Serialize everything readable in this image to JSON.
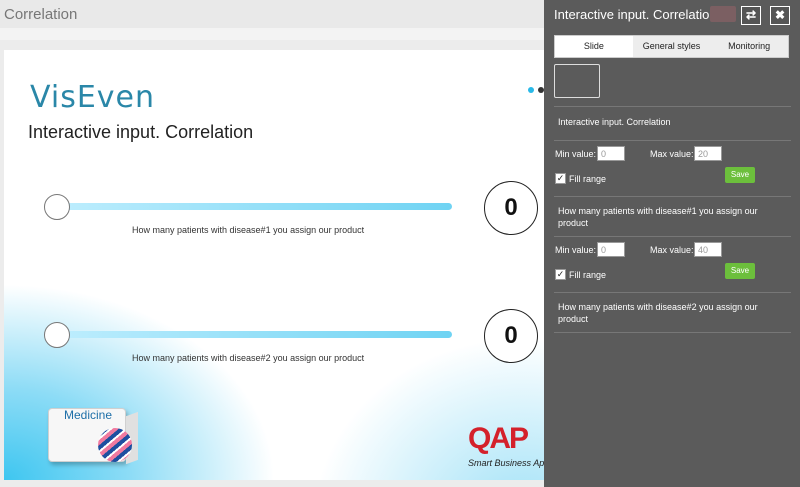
{
  "window": {
    "title": "Correlation"
  },
  "slide": {
    "logo": "VisEven",
    "title": "Interactive input. Correlation",
    "nav_dot_colors": [
      "#29b9e8",
      "#333333"
    ],
    "sliders": [
      {
        "label": "How many patients with disease#1 you assign our product",
        "value": "0"
      },
      {
        "label": "How many patients with disease#2 you assign our product",
        "value": "0"
      }
    ],
    "product_box_label": "Medicine",
    "brand": {
      "name": "QAP",
      "tagline": "Smart Business Ap"
    }
  },
  "panel": {
    "title": "Interactive input. Correlatio...",
    "swap_icon": "swap-icon",
    "close_icon": "close-icon",
    "tabs": [
      {
        "label": "Slide"
      },
      {
        "label": "General styles"
      },
      {
        "label": "Monitoring"
      }
    ],
    "section_title": "Interactive input. Correlation",
    "groups": [
      {
        "min_label": "Min value:",
        "min_value": "0",
        "max_label": "Max value:",
        "max_value": "20",
        "fill_range_label": "Fill range",
        "fill_range_checked": true,
        "save_label": "Save",
        "question": "How many patients with disease#1 you assign our product"
      },
      {
        "min_label": "Min value:",
        "min_value": "0",
        "max_label": "Max value:",
        "max_value": "40",
        "fill_range_label": "Fill range",
        "fill_range_checked": true,
        "save_label": "Save",
        "question": "How many patients with disease#2 you assign our product"
      }
    ]
  },
  "colors": {
    "panel_bg": "#5b5b5b",
    "accent": "#29b9e8",
    "save_green": "#6cbf3c",
    "brand_red": "#d4212b"
  }
}
